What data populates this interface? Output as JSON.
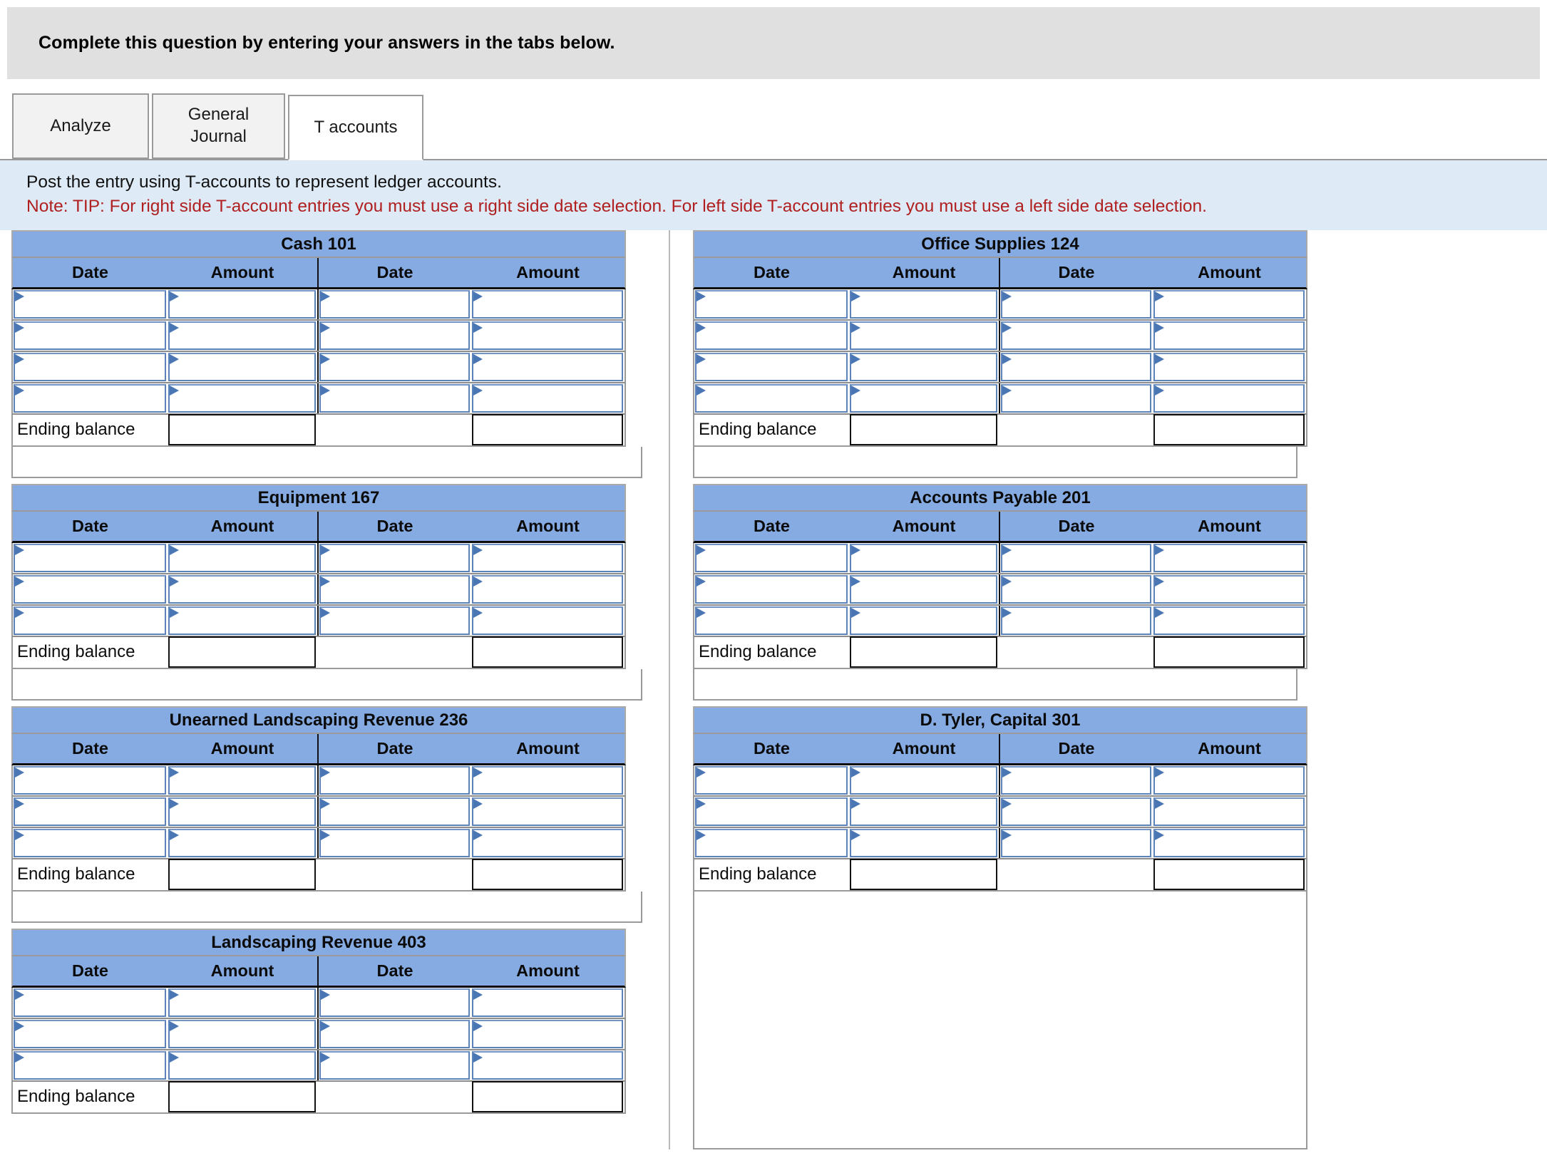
{
  "banner": {
    "text": "Complete this question by entering your answers in the tabs below."
  },
  "tabs": [
    {
      "id": "analyze",
      "label": "Analyze",
      "active": false
    },
    {
      "id": "general-journal",
      "label": "General Journal",
      "active": false
    },
    {
      "id": "t-accounts",
      "label": "T accounts",
      "active": true
    }
  ],
  "instructions": {
    "line1": "Post the entry using T-accounts to represent ledger accounts.",
    "line2": "Note: TIP: For right side T-account entries you must use a right side date selection. For left side T-account entries you must use a left side date selection."
  },
  "column_headers": {
    "date": "Date",
    "amount": "Amount"
  },
  "ending_balance_label": "Ending balance",
  "colors": {
    "header_blue": "#85abe2",
    "instruction_panel": "#deeaf6",
    "banner_gray": "#e0e0e0",
    "note_red": "#b02020",
    "select_border": "#5b83ba",
    "triangle": "#4a77b4"
  },
  "accounts": {
    "left": [
      {
        "title": "Cash 101",
        "rows": 4,
        "ending_balance": true
      },
      {
        "title": "Equipment 167",
        "rows": 3,
        "ending_balance": true
      },
      {
        "title": "Unearned Landscaping Revenue 236",
        "rows": 3,
        "ending_balance": true
      },
      {
        "title": "Landscaping Revenue 403",
        "rows": 3,
        "ending_balance": true
      }
    ],
    "right": [
      {
        "title": "Office Supplies 124",
        "rows": 4,
        "ending_balance": true
      },
      {
        "title": "Accounts Payable 201",
        "rows": 3,
        "ending_balance": true
      },
      {
        "title": "D. Tyler, Capital 301",
        "rows": 3,
        "ending_balance": true
      }
    ]
  }
}
